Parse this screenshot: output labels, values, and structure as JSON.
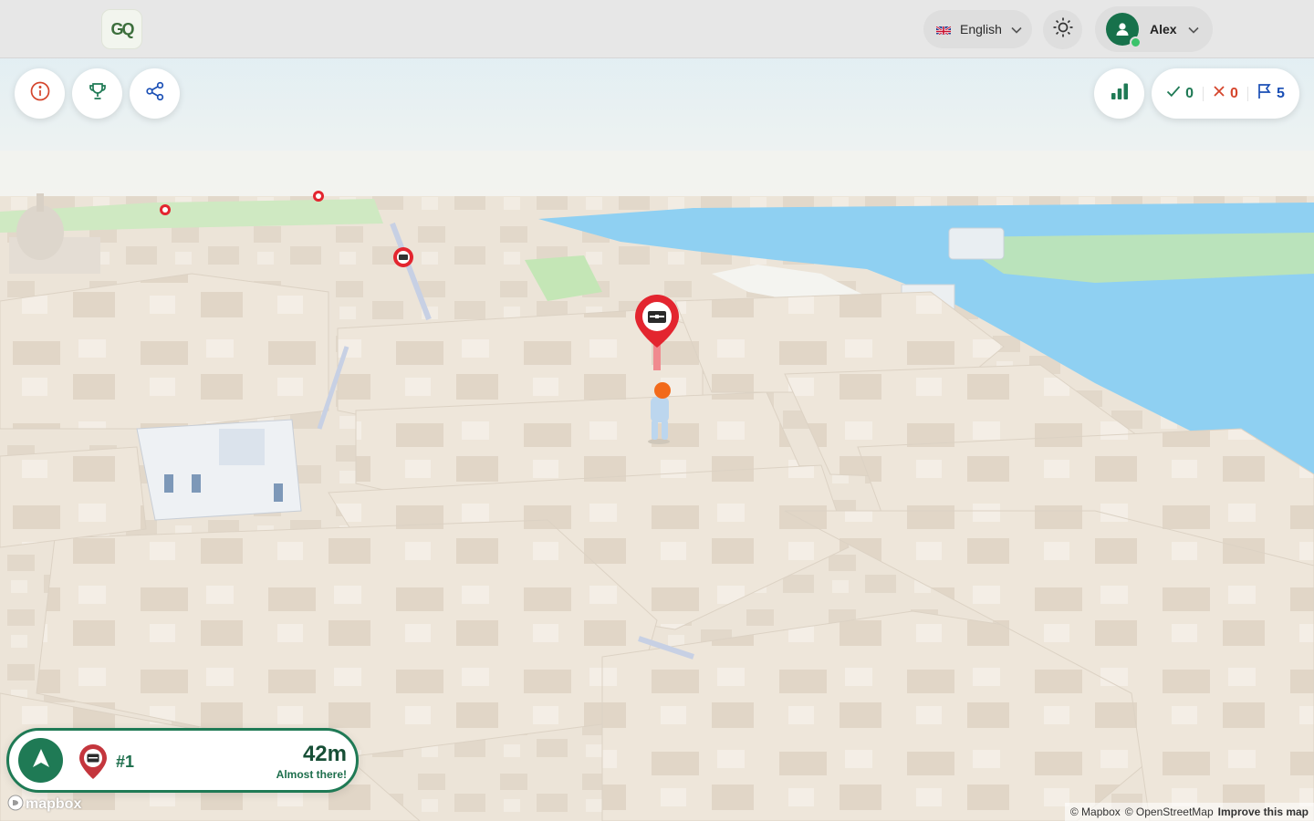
{
  "app": {
    "logo_text": "GQ",
    "logo_icon": "compass-logo"
  },
  "header": {
    "language": {
      "flag": "uk-flag-icon",
      "label": "English"
    },
    "theme_icon": "sun-icon",
    "user": {
      "name": "Alex",
      "status": "online"
    }
  },
  "toolbar": {
    "left_buttons": [
      {
        "icon": "info-icon"
      },
      {
        "icon": "trophy-icon"
      },
      {
        "icon": "share-icon"
      }
    ],
    "stats_icon": "bar-chart-icon"
  },
  "score": {
    "correct": "0",
    "wrong": "0",
    "flags": "5",
    "colors": {
      "correct": "#1f7a55",
      "wrong": "#d5452c",
      "flags": "#1a4fb5"
    }
  },
  "navigation": {
    "target_number": "#1",
    "distance": "42m",
    "status": "Almost there!"
  },
  "map": {
    "brand": "mapbox",
    "attribution": {
      "mapbox": "© Mapbox",
      "osm": "© OpenStreetMap",
      "improve": "Improve this map"
    }
  },
  "colors": {
    "accent": "#1f7a55",
    "marker": "#e3252f",
    "building": "#ece4d8",
    "water": "#8fd0f2",
    "park": "#bfe4b5"
  }
}
